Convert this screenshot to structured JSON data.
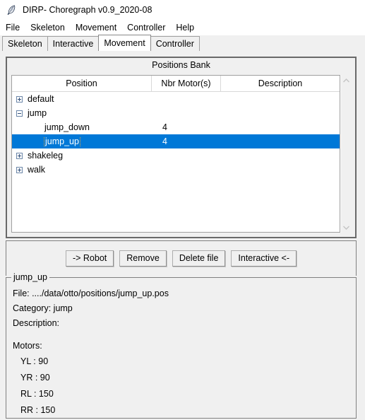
{
  "window": {
    "title": "DIRP- Choregraph v0.9_2020-08",
    "icon": "feather-quill-icon"
  },
  "menubar": {
    "items": [
      {
        "label": "File"
      },
      {
        "label": "Skeleton"
      },
      {
        "label": "Movement"
      },
      {
        "label": "Controller"
      },
      {
        "label": "Help"
      }
    ]
  },
  "tabs": [
    {
      "label": "Skeleton",
      "selected": false
    },
    {
      "label": "Interactive",
      "selected": false
    },
    {
      "label": "Movement",
      "selected": true
    },
    {
      "label": "Controller",
      "selected": false
    }
  ],
  "positions_bank": {
    "title": "Positions Bank",
    "columns": [
      "Position",
      "Nbr Motor(s)",
      "Description"
    ],
    "rows": [
      {
        "expander": "plus",
        "level": 0,
        "position": "default",
        "nbr_motors": "",
        "description": "",
        "selected": false
      },
      {
        "expander": "minus",
        "level": 0,
        "position": "jump",
        "nbr_motors": "",
        "description": "",
        "selected": false
      },
      {
        "expander": "none",
        "level": 1,
        "position": "jump_down",
        "nbr_motors": "4",
        "description": "",
        "selected": false
      },
      {
        "expander": "none",
        "level": 1,
        "position": "jump_up",
        "nbr_motors": "4",
        "description": "",
        "selected": true
      },
      {
        "expander": "plus",
        "level": 0,
        "position": "shakeleg",
        "nbr_motors": "",
        "description": "",
        "selected": false
      },
      {
        "expander": "plus",
        "level": 0,
        "position": "walk",
        "nbr_motors": "",
        "description": "",
        "selected": false
      }
    ],
    "scrollbar": {
      "up_arrow": "chevron-up-icon",
      "down_arrow": "chevron-down-icon"
    },
    "selection_color": "#0078d7"
  },
  "buttons": [
    {
      "label": "-> Robot"
    },
    {
      "label": "Remove"
    },
    {
      "label": "Delete file"
    },
    {
      "label": "Interactive <-"
    }
  ],
  "details": {
    "legend": "jump_up",
    "file": "File: ..../data/otto/positions/jump_up.pos",
    "category": "Category: jump",
    "description": "Description:",
    "motors_label": "Motors:",
    "motors": [
      "YL : 90",
      "YR : 90",
      "RL : 150",
      "RR : 150"
    ]
  }
}
